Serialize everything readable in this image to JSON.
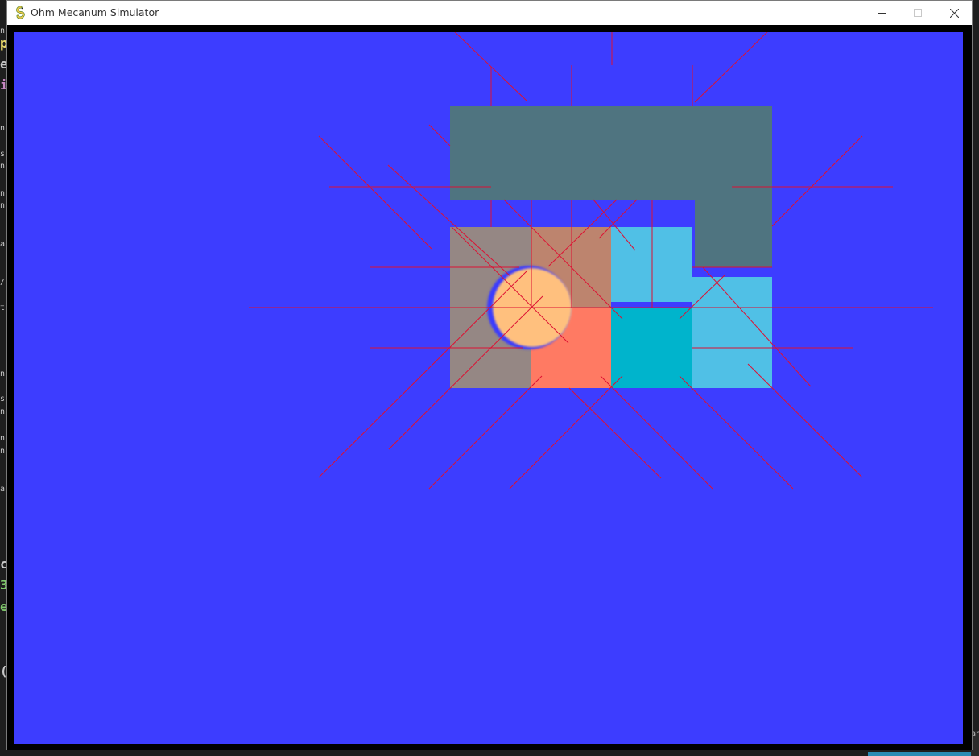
{
  "window": {
    "title": "Ohm Mecanum Simulator",
    "app_icon": "pygame-snake-icon",
    "controls": {
      "minimize": "minimize-icon",
      "maximize": "maximize-icon",
      "close": "close-icon"
    }
  },
  "background_fragments": [
    "n",
    "p",
    "e",
    "i",
    "n",
    "s",
    "n",
    "n",
    "n",
    "a",
    "/",
    "t",
    "n",
    "s",
    "n",
    "n",
    "n",
    "a",
    "c",
    "3",
    "e",
    "("
  ],
  "background_right_tab": "ar",
  "colors": {
    "canvas": "#3d3dff",
    "wall": "#4f7480",
    "tile_gray": "#958784",
    "tile_rose": "#bd846e",
    "tile_salmon": "#ff7a63",
    "tile_sky": "#50c0e6",
    "tile_cyan": "#00b4cc",
    "robot": "#ffc07e",
    "robot_rim": "#3a3aff",
    "sensor_ray": "#dd1133"
  }
}
